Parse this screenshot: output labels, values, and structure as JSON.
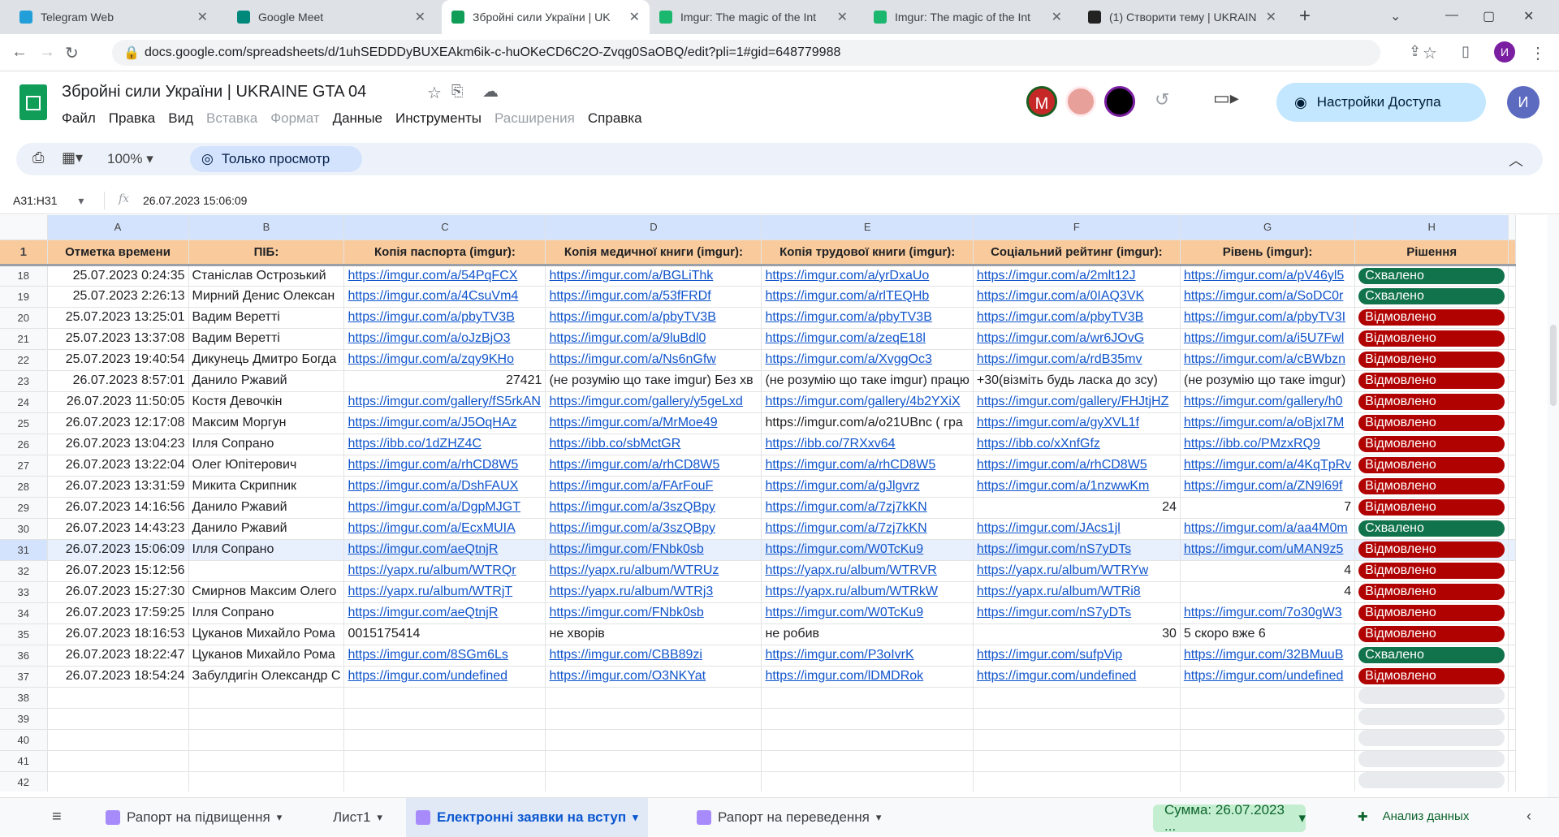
{
  "browser": {
    "tabs": [
      {
        "title": "Telegram Web",
        "active": false
      },
      {
        "title": "Google Meet",
        "active": false
      },
      {
        "title": "Збройні сили України | UK",
        "active": true
      },
      {
        "title": "Imgur: The magic of the Int",
        "active": false
      },
      {
        "title": "Imgur: The magic of the Int",
        "active": false
      },
      {
        "title": "(1) Створити тему | UKRAIN",
        "active": false
      }
    ],
    "url": "docs.google.com/spreadsheets/d/1uhSEDDDyBUXEAkm6ik-c-huOKeCD6C2O-Zvqg0SaOBQ/edit?pli=1#gid=648779988",
    "profile_initial": "И"
  },
  "app": {
    "title": "Збройні сили України | UKRAINE GTA 04",
    "menus": [
      {
        "label": "Файл",
        "disabled": false
      },
      {
        "label": "Правка",
        "disabled": false
      },
      {
        "label": "Вид",
        "disabled": false
      },
      {
        "label": "Вставка",
        "disabled": true
      },
      {
        "label": "Формат",
        "disabled": true
      },
      {
        "label": "Данные",
        "disabled": false
      },
      {
        "label": "Инструменты",
        "disabled": false
      },
      {
        "label": "Расширения",
        "disabled": true
      },
      {
        "label": "Справка",
        "disabled": false
      }
    ],
    "share_label": "Настройки Доступа",
    "avatar_initial": "И",
    "collab_initial": "М"
  },
  "toolbar": {
    "zoom": "100%",
    "view_only_label": "Только просмотр"
  },
  "formula_bar": {
    "range": "A31:H31",
    "value": "26.07.2023 15:06:09"
  },
  "columns": [
    "A",
    "B",
    "C",
    "D",
    "E",
    "F",
    "G",
    "H"
  ],
  "headers": [
    "Отметка времени",
    "ПІБ:",
    "Копія паспорта (imgur):",
    "Копія медичної книги (imgur):",
    "Копія трудової книги (imgur):",
    "Соціальний рейтинг (imgur):",
    "Рівень (imgur):",
    "Рішення"
  ],
  "rows": [
    {
      "n": "18",
      "a": "25.07.2023 0:24:35",
      "b": "Станіслав Острозький",
      "c": "https://imgur.com/a/54PqFCX",
      "d": "https://imgur.com/a/BGLiThk",
      "e": "https://imgur.com/a/yrDxaUo",
      "f": "https://imgur.com/a/2mlt12J",
      "g": "https://imgur.com/a/pV46yl5",
      "h": "Схвалено"
    },
    {
      "n": "19",
      "a": "25.07.2023 2:26:13",
      "b": "Мирний Денис Олексан",
      "c": "https://imgur.com/a/4CsuVm4",
      "d": "https://imgur.com/a/53fFRDf",
      "e": "https://imgur.com/a/rlTEQHb",
      "f": "https://imgur.com/a/0IAQ3VK",
      "g": "https://imgur.com/a/SoDC0r",
      "h": "Схвалено"
    },
    {
      "n": "20",
      "a": "25.07.2023 13:25:01",
      "b": "Вадим Веретті",
      "c": "https://imgur.com/a/pbyTV3B",
      "d": "https://imgur.com/a/pbyTV3B",
      "e": "https://imgur.com/a/pbyTV3B",
      "f": "https://imgur.com/a/pbyTV3B",
      "g": "https://imgur.com/a/pbyTV3I",
      "h": "Відмовлено"
    },
    {
      "n": "21",
      "a": "25.07.2023 13:37:08",
      "b": "Вадим Веретті",
      "c": "https://imgur.com/a/oJzBjO3",
      "d": "https://imgur.com/a/9luBdl0",
      "e": "https://imgur.com/a/zeqE18l",
      "f": "https://imgur.com/a/wr6JOvG",
      "g": "https://imgur.com/a/i5U7Fwl",
      "h": "Відмовлено"
    },
    {
      "n": "22",
      "a": "25.07.2023 19:40:54",
      "b": "Дикунець Дмитро Богда",
      "c": "https://imgur.com/a/zqy9KHo",
      "d": "https://imgur.com/a/Ns6nGfw",
      "e": "https://imgur.com/a/XvggOc3",
      "f": "https://imgur.com/a/rdB35mv",
      "g": "https://imgur.com/a/cBWbzn",
      "h": "Відмовлено"
    },
    {
      "n": "23",
      "a": "26.07.2023 8:57:01",
      "b": "Данило Ржавий",
      "c": "27421",
      "d": "(не розумію що таке imgur) Без хв",
      "e": "(не розумію що таке imgur) працю",
      "f": "+30(візміть будь ласка до зсу)",
      "g": "(не розумію що таке imgur)",
      "h": "Відмовлено",
      "plain": [
        "c",
        "d",
        "e",
        "f",
        "g"
      ],
      "numeric": [
        "c"
      ]
    },
    {
      "n": "24",
      "a": "26.07.2023 11:50:05",
      "b": "Костя Девочкін",
      "c": "https://imgur.com/gallery/fS5rkAN",
      "d": "https://imgur.com/gallery/y5geLxd",
      "e": "https://imgur.com/gallery/4b2YXiX",
      "f": "https://imgur.com/gallery/FHJtjHZ",
      "g": "https://imgur.com/gallery/h0",
      "h": "Відмовлено"
    },
    {
      "n": "25",
      "a": "26.07.2023 12:17:08",
      "b": "Максим Моргун",
      "c": "https://imgur.com/a/J5OqHAz",
      "d": "https://imgur.com/a/MrMoe49",
      "e": "https://imgur.com/a/o21UBnc ( гра",
      "f": "https://imgur.com/a/gyXVL1f",
      "g": "https://imgur.com/a/oBjxI7M",
      "h": "Відмовлено",
      "plain": [
        "e"
      ]
    },
    {
      "n": "26",
      "a": "26.07.2023 13:04:23",
      "b": "Ілля Сопрано",
      "c": "https://ibb.co/1dZHZ4C",
      "d": "https://ibb.co/sbMctGR",
      "e": "https://ibb.co/7RXxv64",
      "f": "https://ibb.co/xXnfGfz",
      "g": "https://ibb.co/PMzxRQ9",
      "h": "Відмовлено"
    },
    {
      "n": "27",
      "a": "26.07.2023 13:22:04",
      "b": "Олег Юпітерович",
      "c": "https://imgur.com/a/rhCD8W5",
      "d": "https://imgur.com/a/rhCD8W5",
      "e": "https://imgur.com/a/rhCD8W5",
      "f": "https://imgur.com/a/rhCD8W5",
      "g": "https://imgur.com/a/4KqTpRv",
      "h": "Відмовлено"
    },
    {
      "n": "28",
      "a": "26.07.2023 13:31:59",
      "b": "Микита Скрипник",
      "c": "https://imgur.com/a/DshFAUX",
      "d": "https://imgur.com/a/FArFouF",
      "e": "https://imgur.com/a/gJlgvrz",
      "f": "https://imgur.com/a/1nzwwKm",
      "g": "https://imgur.com/a/ZN9l69f",
      "h": "Відмовлено"
    },
    {
      "n": "29",
      "a": "26.07.2023 14:16:56",
      "b": "Данило Ржавий",
      "c": "https://imgur.com/a/DgpMJGT",
      "d": "https://imgur.com/a/3szQBpy",
      "e": "https://imgur.com/a/7zj7kKN",
      "f": "24",
      "g": "7",
      "h": "Відмовлено",
      "plain": [
        "f",
        "g"
      ],
      "numeric": [
        "f",
        "g"
      ]
    },
    {
      "n": "30",
      "a": "26.07.2023 14:43:23",
      "b": "Данило Ржавий",
      "c": "https://imgur.com/a/EcxMUIA",
      "d": "https://imgur.com/a/3szQBpy",
      "e": "https://imgur.com/a/7zj7kKN",
      "f": "https://imgur.com/JAcs1jl",
      "g": "https://imgur.com/a/aa4M0m",
      "h": "Схвалено"
    },
    {
      "n": "31",
      "a": "26.07.2023 15:06:09",
      "b": "Ілля Сопрано",
      "c": "https://imgur.com/aeQtnjR",
      "d": "https://imgur.com/FNbk0sb",
      "e": "https://imgur.com/W0TcKu9",
      "f": "https://imgur.com/nS7yDTs",
      "g": "https://imgur.com/uMAN9z5",
      "h": "Відмовлено",
      "selected": true
    },
    {
      "n": "32",
      "a": "26.07.2023 15:12:56",
      "b": "",
      "c": "https://yapx.ru/album/WTRQr",
      "d": "https://yapx.ru/album/WTRUz",
      "e": "https://yapx.ru/album/WTRVR",
      "f": "https://yapx.ru/album/WTRYw",
      "g": "4",
      "h": "Відмовлено",
      "plain": [
        "g"
      ],
      "numeric": [
        "g"
      ]
    },
    {
      "n": "33",
      "a": "26.07.2023 15:27:30",
      "b": "Смирнов Максим Олего",
      "c": "https://yapx.ru/album/WTRjT",
      "d": "https://yapx.ru/album/WTRj3",
      "e": "https://yapx.ru/album/WTRkW",
      "f": "https://yapx.ru/album/WTRi8",
      "g": "4",
      "h": "Відмовлено",
      "plain": [
        "g"
      ],
      "numeric": [
        "g"
      ]
    },
    {
      "n": "34",
      "a": "26.07.2023 17:59:25",
      "b": "Ілля Сопрано",
      "c": "https://imgur.com/aeQtnjR",
      "d": "https://imgur.com/FNbk0sb",
      "e": "https://imgur.com/W0TcKu9",
      "f": "https://imgur.com/nS7yDTs",
      "g": "https://imgur.com/7o30gW3",
      "h": "Відмовлено"
    },
    {
      "n": "35",
      "a": "26.07.2023 18:16:53",
      "b": "Цуканов Михайло Рома",
      "c": "0015175414",
      "d": "не хворів",
      "e": "не робив",
      "f": "30",
      "g": "5 скоро вже 6",
      "h": "Відмовлено",
      "plain": [
        "c",
        "d",
        "e",
        "f",
        "g"
      ],
      "numeric": [
        "f"
      ]
    },
    {
      "n": "36",
      "a": "26.07.2023 18:22:47",
      "b": "Цуканов Михайло Рома",
      "c": "https://imgur.com/8SGm6Ls",
      "d": "https://imgur.com/CBB89zi",
      "e": "https://imgur.com/P3oIvrK",
      "f": "https://imgur.com/sufpVip",
      "g": "https://imgur.com/32BMuuB",
      "h": "Схвалено"
    },
    {
      "n": "37",
      "a": "26.07.2023 18:54:24",
      "b": "Забулдигін Олександр С",
      "c": "https://imgur.com/undefined",
      "d": "https://imgur.com/O3NKYat",
      "e": "https://imgur.com/lDMDRok",
      "f": "https://imgur.com/undefined",
      "g": "https://imgur.com/undefined",
      "h": "Відмовлено"
    }
  ],
  "empty_rows": [
    "38",
    "39",
    "40",
    "41",
    "42"
  ],
  "status_colors": {
    "Схвалено": "#11734b",
    "Відмовлено": "#b10202"
  },
  "sheets": [
    {
      "label": "Рапорт на підвищення",
      "active": false,
      "icon": true
    },
    {
      "label": "Лист1",
      "active": false,
      "icon": false
    },
    {
      "label": "Електронні заявки на вступ",
      "active": true,
      "icon": true
    },
    {
      "label": "Рапорт на переведення",
      "active": false,
      "icon": true
    }
  ],
  "sum_label": "Сумма: 26.07.2023 ...",
  "explore_label": "Анализ данных"
}
